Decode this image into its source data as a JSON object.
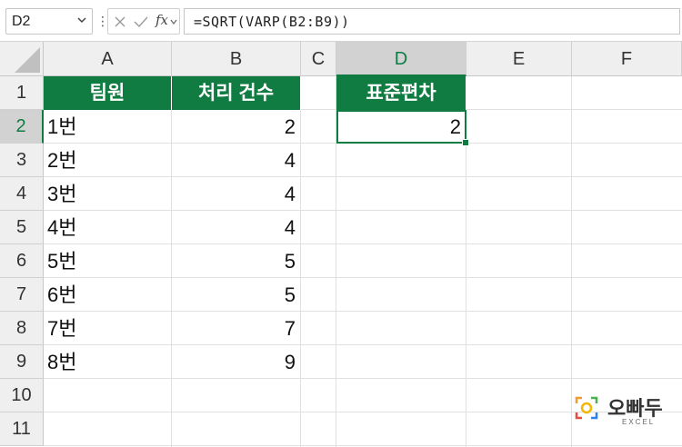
{
  "name_box": "D2",
  "formula": "=SQRT(VARP(B2:B9))",
  "column_headers": [
    "A",
    "B",
    "C",
    "D",
    "E",
    "F"
  ],
  "row_headers": [
    "1",
    "2",
    "3",
    "4",
    "5",
    "6",
    "7",
    "8",
    "9",
    "10",
    "11"
  ],
  "table": {
    "header_team": "팀원",
    "header_count": "처리 건수",
    "rows": [
      {
        "team": "1번",
        "count": "2"
      },
      {
        "team": "2번",
        "count": "4"
      },
      {
        "team": "3번",
        "count": "4"
      },
      {
        "team": "4번",
        "count": "4"
      },
      {
        "team": "5번",
        "count": "5"
      },
      {
        "team": "6번",
        "count": "5"
      },
      {
        "team": "7번",
        "count": "7"
      },
      {
        "team": "8번",
        "count": "9"
      }
    ]
  },
  "result": {
    "header": "표준편차",
    "value": "2"
  },
  "selected_cell": "D2",
  "accent_color": "#107c41",
  "logo": {
    "name": "오빠두",
    "sub": "EXCEL"
  }
}
